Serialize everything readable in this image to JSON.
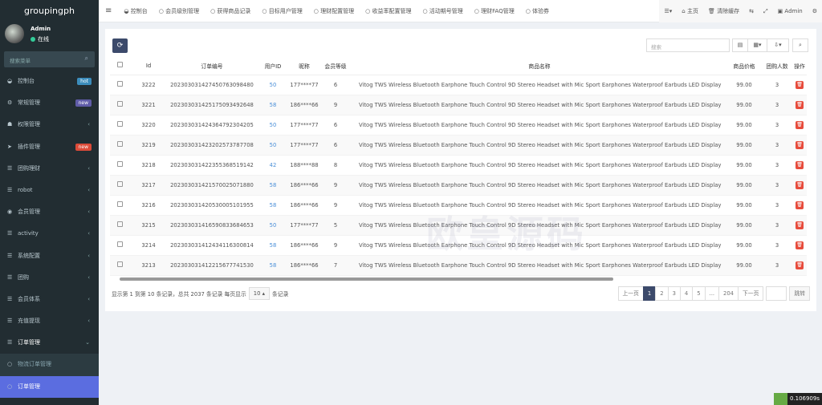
{
  "sidebar": {
    "logo": "groupingph",
    "user": "Admin",
    "status": "在线",
    "search_placeholder": "搜索菜单",
    "items": [
      {
        "label": "控制台",
        "icon": "dashboard-icon",
        "badge": "hot",
        "badge_color": "#3c8dbc"
      },
      {
        "label": "常规管理",
        "icon": "cogs-icon",
        "badge": "new",
        "badge_color": "#605ca8"
      },
      {
        "label": "权限管理",
        "icon": "group-icon"
      },
      {
        "label": "插件管理",
        "icon": "rocket-icon",
        "badge": "new",
        "badge_color": "#dd4b39"
      },
      {
        "label": "团购理财",
        "icon": "list-icon"
      },
      {
        "label": "robot",
        "icon": "list-icon"
      },
      {
        "label": "会员管理",
        "icon": "user-circle-icon"
      },
      {
        "label": "activity",
        "icon": "list-icon"
      },
      {
        "label": "系统配置",
        "icon": "list-icon"
      },
      {
        "label": "团购",
        "icon": "list-icon"
      },
      {
        "label": "会员体系",
        "icon": "list-icon"
      },
      {
        "label": "充值提现",
        "icon": "list-icon"
      },
      {
        "label": "订单管理",
        "icon": "list-icon",
        "open": true
      }
    ],
    "subitems": [
      {
        "label": "物流订单管理"
      },
      {
        "label": "订单管理",
        "active": true
      }
    ]
  },
  "topbar": {
    "tabs": [
      "控制台",
      "会员级别管理",
      "获得商品记录",
      "目标用户管理",
      "理财配置管理",
      "收益率配置管理",
      "活动期号管理",
      "理财FAQ管理",
      "体验券"
    ],
    "home": "主页",
    "clear_cache": "清除缓存",
    "admin": "Admin"
  },
  "toolbar": {
    "search_placeholder": "搜索"
  },
  "table": {
    "headers": [
      "Id",
      "订单编号",
      "用户ID",
      "昵称",
      "会员等级",
      "商品名称",
      "商品价格",
      "团购人数",
      "操作"
    ],
    "rows": [
      [
        "3222",
        "20230303142745076309848​0",
        "50",
        "177****77",
        "6"
      ],
      [
        "3221",
        "202303031425175093492648",
        "58",
        "186****66",
        "9"
      ],
      [
        "3220",
        "202303031424364792304205",
        "50",
        "177****77",
        "6"
      ],
      [
        "3219",
        "202303031423202573787708",
        "50",
        "177****77",
        "6"
      ],
      [
        "3218",
        "202303031422355368519142",
        "42",
        "188****88",
        "8"
      ],
      [
        "3217",
        "202303031421570025071880",
        "58",
        "186****66",
        "9"
      ],
      [
        "3216",
        "202303031420530005101955",
        "58",
        "186****66",
        "9"
      ],
      [
        "3215",
        "202303031416590833684653",
        "50",
        "177****77",
        "5"
      ],
      [
        "3214",
        "202303031412434116300814",
        "58",
        "186****66",
        "9"
      ],
      [
        "3213",
        "202303031412215677741530",
        "58",
        "186****66",
        "7"
      ]
    ],
    "product": "Vitog TWS Wireless Bluetooth Earphone Touch Control 9D Stereo Headset with Mic Sport Earphones Waterproof Earbuds LED Display",
    "price": "99.00",
    "group_count": "3"
  },
  "pagination": {
    "info_prefix": "显示第 1 到第 10 条记录，总共 2037 条记录 每页显示",
    "page_size": "10",
    "info_suffix": "条记录",
    "pages": [
      "上一页",
      "1",
      "2",
      "3",
      "4",
      "5",
      "...",
      "204",
      "下一页"
    ],
    "current": "1",
    "jump": "跳转"
  },
  "watermark": "欧皇源码",
  "timer": "0.106909s"
}
